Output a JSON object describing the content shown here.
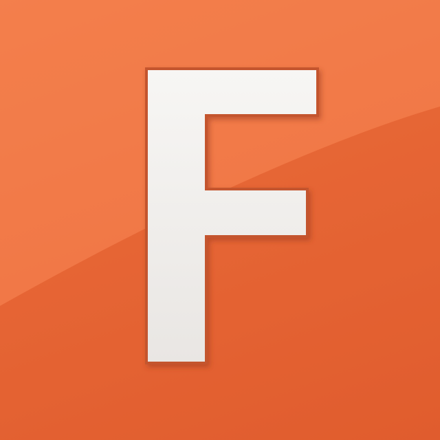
{
  "logo": {
    "letter": "F",
    "colors": {
      "background_top": "#f07a45",
      "background_bottom": "#e25f30",
      "glyph_fill": "#f3f1ef",
      "glyph_shadow": "#b8482a"
    }
  }
}
